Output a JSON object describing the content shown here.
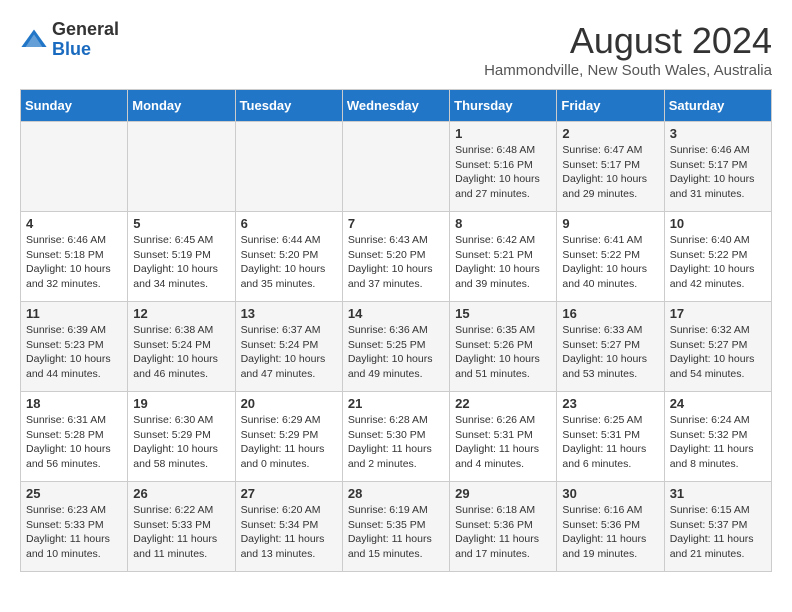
{
  "header": {
    "logo_general": "General",
    "logo_blue": "Blue",
    "month_year": "August 2024",
    "location": "Hammondville, New South Wales, Australia"
  },
  "calendar": {
    "days_of_week": [
      "Sunday",
      "Monday",
      "Tuesday",
      "Wednesday",
      "Thursday",
      "Friday",
      "Saturday"
    ],
    "weeks": [
      [
        {
          "day": "",
          "info": ""
        },
        {
          "day": "",
          "info": ""
        },
        {
          "day": "",
          "info": ""
        },
        {
          "day": "",
          "info": ""
        },
        {
          "day": "1",
          "info": "Sunrise: 6:48 AM\nSunset: 5:16 PM\nDaylight: 10 hours and 27 minutes."
        },
        {
          "day": "2",
          "info": "Sunrise: 6:47 AM\nSunset: 5:17 PM\nDaylight: 10 hours and 29 minutes."
        },
        {
          "day": "3",
          "info": "Sunrise: 6:46 AM\nSunset: 5:17 PM\nDaylight: 10 hours and 31 minutes."
        }
      ],
      [
        {
          "day": "4",
          "info": "Sunrise: 6:46 AM\nSunset: 5:18 PM\nDaylight: 10 hours and 32 minutes."
        },
        {
          "day": "5",
          "info": "Sunrise: 6:45 AM\nSunset: 5:19 PM\nDaylight: 10 hours and 34 minutes."
        },
        {
          "day": "6",
          "info": "Sunrise: 6:44 AM\nSunset: 5:20 PM\nDaylight: 10 hours and 35 minutes."
        },
        {
          "day": "7",
          "info": "Sunrise: 6:43 AM\nSunset: 5:20 PM\nDaylight: 10 hours and 37 minutes."
        },
        {
          "day": "8",
          "info": "Sunrise: 6:42 AM\nSunset: 5:21 PM\nDaylight: 10 hours and 39 minutes."
        },
        {
          "day": "9",
          "info": "Sunrise: 6:41 AM\nSunset: 5:22 PM\nDaylight: 10 hours and 40 minutes."
        },
        {
          "day": "10",
          "info": "Sunrise: 6:40 AM\nSunset: 5:22 PM\nDaylight: 10 hours and 42 minutes."
        }
      ],
      [
        {
          "day": "11",
          "info": "Sunrise: 6:39 AM\nSunset: 5:23 PM\nDaylight: 10 hours and 44 minutes."
        },
        {
          "day": "12",
          "info": "Sunrise: 6:38 AM\nSunset: 5:24 PM\nDaylight: 10 hours and 46 minutes."
        },
        {
          "day": "13",
          "info": "Sunrise: 6:37 AM\nSunset: 5:24 PM\nDaylight: 10 hours and 47 minutes."
        },
        {
          "day": "14",
          "info": "Sunrise: 6:36 AM\nSunset: 5:25 PM\nDaylight: 10 hours and 49 minutes."
        },
        {
          "day": "15",
          "info": "Sunrise: 6:35 AM\nSunset: 5:26 PM\nDaylight: 10 hours and 51 minutes."
        },
        {
          "day": "16",
          "info": "Sunrise: 6:33 AM\nSunset: 5:27 PM\nDaylight: 10 hours and 53 minutes."
        },
        {
          "day": "17",
          "info": "Sunrise: 6:32 AM\nSunset: 5:27 PM\nDaylight: 10 hours and 54 minutes."
        }
      ],
      [
        {
          "day": "18",
          "info": "Sunrise: 6:31 AM\nSunset: 5:28 PM\nDaylight: 10 hours and 56 minutes."
        },
        {
          "day": "19",
          "info": "Sunrise: 6:30 AM\nSunset: 5:29 PM\nDaylight: 10 hours and 58 minutes."
        },
        {
          "day": "20",
          "info": "Sunrise: 6:29 AM\nSunset: 5:29 PM\nDaylight: 11 hours and 0 minutes."
        },
        {
          "day": "21",
          "info": "Sunrise: 6:28 AM\nSunset: 5:30 PM\nDaylight: 11 hours and 2 minutes."
        },
        {
          "day": "22",
          "info": "Sunrise: 6:26 AM\nSunset: 5:31 PM\nDaylight: 11 hours and 4 minutes."
        },
        {
          "day": "23",
          "info": "Sunrise: 6:25 AM\nSunset: 5:31 PM\nDaylight: 11 hours and 6 minutes."
        },
        {
          "day": "24",
          "info": "Sunrise: 6:24 AM\nSunset: 5:32 PM\nDaylight: 11 hours and 8 minutes."
        }
      ],
      [
        {
          "day": "25",
          "info": "Sunrise: 6:23 AM\nSunset: 5:33 PM\nDaylight: 11 hours and 10 minutes."
        },
        {
          "day": "26",
          "info": "Sunrise: 6:22 AM\nSunset: 5:33 PM\nDaylight: 11 hours and 11 minutes."
        },
        {
          "day": "27",
          "info": "Sunrise: 6:20 AM\nSunset: 5:34 PM\nDaylight: 11 hours and 13 minutes."
        },
        {
          "day": "28",
          "info": "Sunrise: 6:19 AM\nSunset: 5:35 PM\nDaylight: 11 hours and 15 minutes."
        },
        {
          "day": "29",
          "info": "Sunrise: 6:18 AM\nSunset: 5:36 PM\nDaylight: 11 hours and 17 minutes."
        },
        {
          "day": "30",
          "info": "Sunrise: 6:16 AM\nSunset: 5:36 PM\nDaylight: 11 hours and 19 minutes."
        },
        {
          "day": "31",
          "info": "Sunrise: 6:15 AM\nSunset: 5:37 PM\nDaylight: 11 hours and 21 minutes."
        }
      ]
    ]
  }
}
